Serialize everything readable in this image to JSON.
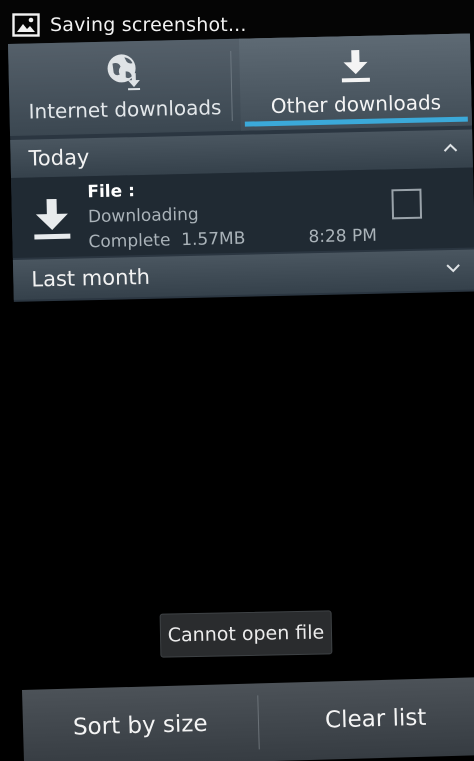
{
  "statusbar": {
    "icon": "image-icon",
    "text": "Saving screenshot..."
  },
  "tabs": [
    {
      "label": "Internet downloads",
      "icon": "globe-download-icon",
      "selected": false
    },
    {
      "label": "Other downloads",
      "icon": "download-icon",
      "selected": true
    }
  ],
  "sections": {
    "today": {
      "label": "Today",
      "expanded": true
    },
    "last_month": {
      "label": "Last month",
      "expanded": false
    }
  },
  "item": {
    "title": "File :",
    "status": "Downloading",
    "size": "Complete  1.57MB",
    "time": "8:28 PM",
    "checked": false
  },
  "toast": {
    "text": "Cannot open file"
  },
  "actions": {
    "sort_label": "Sort by size",
    "clear_label": "Clear list"
  },
  "colors": {
    "accent": "#3ba9d9",
    "panel": "#2b3641",
    "header": "#404c56"
  }
}
